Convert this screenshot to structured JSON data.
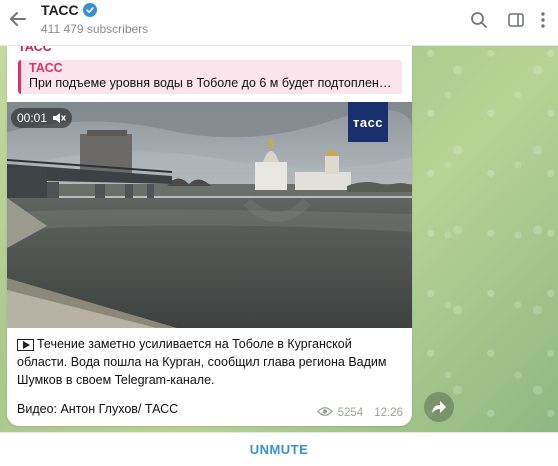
{
  "header": {
    "title": "ТАСС",
    "subscribers": "411 479 subscribers"
  },
  "message": {
    "sender": "ТАСС",
    "reply": {
      "name": "ТАСС",
      "text": "При подъеме уровня воды в Тоболе до 6 м будет подтоплени..."
    },
    "video": {
      "time": "00:01",
      "logo": "тасс"
    },
    "caption": "Течение заметно усиливается на Тоболе в Курганской области. Вода пошла на Курган, сообщил глава региона Вадим Шумков в своем Telegram-канале.",
    "credit": "Видео: Антон Глухов/ ТАСС",
    "views": "5254",
    "time": "12:26"
  },
  "bottom": {
    "unmute_label": "UNMUTE"
  },
  "colors": {
    "accent": "#3a8fd4",
    "sender": "#c2245a",
    "reply_bar": "#d9346a",
    "verified": "#3a8fd4"
  },
  "icons": [
    "back-arrow-icon",
    "verified-icon",
    "search-icon",
    "sidebar-icon",
    "more-icon",
    "mute-icon",
    "play-icon",
    "eye-icon",
    "share-icon"
  ]
}
